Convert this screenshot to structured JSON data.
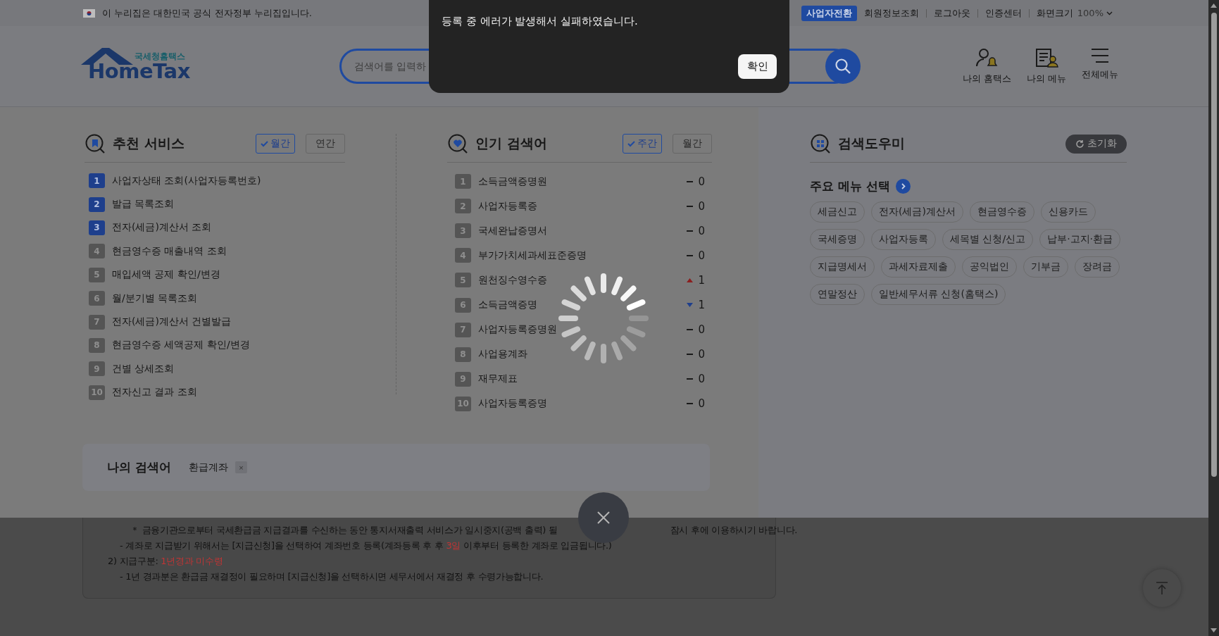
{
  "gov_banner": {
    "text": "이 누리집은 대한민국 공식 전자정부 누리집입니다."
  },
  "utility_links": [
    {
      "label": "사업자전환",
      "kind": "badge"
    },
    {
      "label": "회원정보조회",
      "kind": "link"
    },
    {
      "label": "로그아웃",
      "kind": "link"
    },
    {
      "label": "인증센터",
      "kind": "link"
    },
    {
      "label": "화면크기",
      "kind": "link"
    },
    {
      "label": "100%",
      "kind": "dropdown"
    }
  ],
  "header": {
    "logo_caption": "국세청홈택스",
    "logo_text": "HomeTax",
    "search": {
      "placeholder": "검색어를 입력하"
    },
    "shortcuts": [
      {
        "label": "나의 홈택스",
        "kind": "profile"
      },
      {
        "label": "나의 메뉴",
        "kind": "menu-doc"
      },
      {
        "label": "전체메뉴",
        "kind": "all"
      }
    ]
  },
  "alert": {
    "message": "등록 중 에러가 발생해서 실패하였습니다.",
    "button": "확인"
  },
  "recommended": {
    "title": "추천 서비스",
    "periods": [
      {
        "label": "월간",
        "selected": true
      },
      {
        "label": "연간",
        "selected": false
      }
    ],
    "items": [
      {
        "rank": "1",
        "label": "사업자상태 조회(사업자등록번호)",
        "highlighted": true
      },
      {
        "rank": "2",
        "label": "발급 목록조회",
        "highlighted": true
      },
      {
        "rank": "3",
        "label": "전자(세금)계산서 조회",
        "highlighted": true
      },
      {
        "rank": "4",
        "label": "현금영수증 매출내역 조회",
        "highlighted": false
      },
      {
        "rank": "5",
        "label": "매입세액 공제 확인/변경",
        "highlighted": false
      },
      {
        "rank": "6",
        "label": "월/분기별 목록조회",
        "highlighted": false
      },
      {
        "rank": "7",
        "label": "전자(세금)계산서 건별발급",
        "highlighted": false
      },
      {
        "rank": "8",
        "label": "현금영수증 세액공제 확인/변경",
        "highlighted": false
      },
      {
        "rank": "9",
        "label": "건별 상세조회",
        "highlighted": false
      },
      {
        "rank": "10",
        "label": "전자신고 결과 조회",
        "highlighted": false
      }
    ]
  },
  "popular": {
    "title": "인기 검색어",
    "periods": [
      {
        "label": "주간",
        "selected": true
      },
      {
        "label": "월간",
        "selected": false
      }
    ],
    "items": [
      {
        "rank": "1",
        "label": "소득금액증명원",
        "kind": "same",
        "change": "0"
      },
      {
        "rank": "2",
        "label": "사업자등록증",
        "kind": "same",
        "change": "0"
      },
      {
        "rank": "3",
        "label": "국세완납증명서",
        "kind": "same",
        "change": "0"
      },
      {
        "rank": "4",
        "label": "부가가치세과세표준증명",
        "kind": "same",
        "change": "0"
      },
      {
        "rank": "5",
        "label": "원천징수영수증",
        "kind": "up",
        "change": "1"
      },
      {
        "rank": "6",
        "label": "소득금액증명",
        "kind": "down",
        "change": "1"
      },
      {
        "rank": "7",
        "label": "사업자등록증명원",
        "kind": "same",
        "change": "0"
      },
      {
        "rank": "8",
        "label": "사업용계좌",
        "kind": "same",
        "change": "0"
      },
      {
        "rank": "9",
        "label": "재무제표",
        "kind": "same",
        "change": "0"
      },
      {
        "rank": "10",
        "label": "사업자등록증명",
        "kind": "same",
        "change": "0"
      }
    ]
  },
  "helper": {
    "title": "검색도우미",
    "reset": "초기화",
    "subtitle": "주요 메뉴 선택",
    "chips": [
      "세금신고",
      "전자(세금)계산서",
      "현금영수증",
      "신용카드",
      "국세증명",
      "사업자등록",
      "세목별 신청/신고",
      "납부·고지·환급",
      "지급명세서",
      "과세자료제출",
      "공익법인",
      "기부금",
      "장려금",
      "연말정산",
      "일반세무서류 신청(홈택스)"
    ]
  },
  "my_searches": {
    "title": "나의 검색어",
    "terms": [
      {
        "label": "환급계좌",
        "remove": "×"
      }
    ]
  },
  "notice": {
    "lines": [
      {
        "kind": "note",
        "segments": [
          {
            "text": "＊ 금융기관으로부터 국세환급금 지급결과를 수신하는 동안 통지서재출력 서비스가 일시중지(공백 출력) 될",
            "highlight": false
          },
          {
            "text": "잠시 후에 이용하시기 바랍니다.",
            "highlight": false
          }
        ]
      },
      {
        "kind": "dash",
        "segments": [
          {
            "text": "- 계좌로 지급받기 위해서는 [지급신청]을 선택하여 계좌번호 등록(계좌등록 후 후 ",
            "highlight": false
          },
          {
            "text": "3일",
            "highlight": true
          },
          {
            "text": " 이후부터 등록한 계좌로 입금됩니다.)",
            "highlight": false
          }
        ]
      },
      {
        "kind": "heading",
        "segments": [
          {
            "text": "2) 지급구분: ",
            "highlight": false
          },
          {
            "text": "1년경과 미수령",
            "highlight": true
          }
        ]
      },
      {
        "kind": "dash",
        "segments": [
          {
            "text": "- 1년 경과분은 환급금 재결정이 필요하며 [지급신청]을 선택하시면 세무서에서 재결정 후 수령가능합니다.",
            "highlight": false
          }
        ]
      }
    ]
  }
}
